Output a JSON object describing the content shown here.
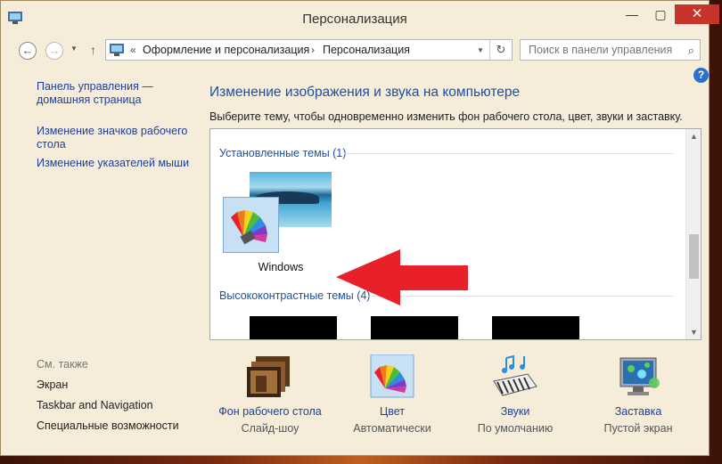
{
  "window": {
    "title": "Персонализация"
  },
  "navbar": {
    "crumb_prefix": "«",
    "crumb_1": "Оформление и персонализация",
    "crumb_sep": "›",
    "crumb_2": "Персонализация",
    "search_placeholder": "Поиск в панели управления"
  },
  "left_nav": {
    "home_link": "Панель управления — домашняя страница",
    "change_icons": "Изменение значков рабочего стола",
    "change_pointers": "Изменение указателей мыши"
  },
  "main": {
    "heading": "Изменение изображения и звука на компьютере",
    "description": "Выберите тему, чтобы одновременно изменить фон рабочего стола, цвет, звуки и заставку."
  },
  "themes": {
    "installed_label": "Установленные темы (1)",
    "installed": [
      {
        "name": "Windows"
      }
    ],
    "contrast_label": "Высококонтрастные темы (4)"
  },
  "see_also": {
    "heading": "См. также",
    "items": [
      "Экран",
      "Taskbar and Navigation",
      "Специальные возможности"
    ]
  },
  "bottom": [
    {
      "name": "Фон рабочего стола",
      "value": "Слайд-шоу",
      "icon": "desktop-background-icon"
    },
    {
      "name": "Цвет",
      "value": "Автоматически",
      "icon": "color-icon"
    },
    {
      "name": "Звуки",
      "value": "По умолчанию",
      "icon": "sounds-icon"
    },
    {
      "name": "Заставка",
      "value": "Пустой экран",
      "icon": "screensaver-icon"
    }
  ],
  "colors": {
    "link": "#1f3f99",
    "heading": "#1e4f9e",
    "close_button": "#c7352a",
    "arrow": "#e8202a"
  }
}
